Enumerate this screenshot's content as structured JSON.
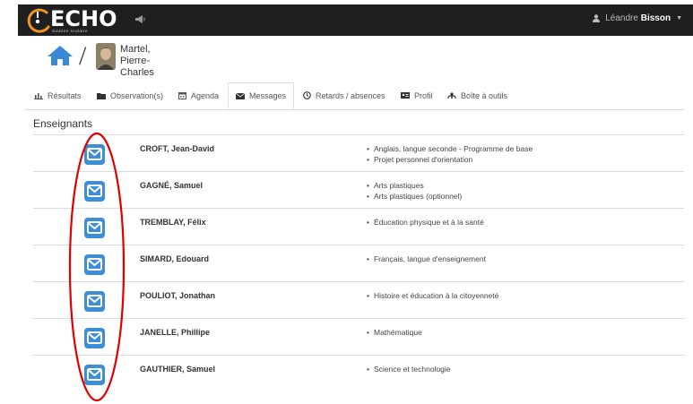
{
  "app": {
    "logo": "ECHO",
    "logo_sub": "Soutien scolaire"
  },
  "user": {
    "first_name": "Léandre",
    "last_name": "Bisson"
  },
  "breadcrumb": {
    "separator": "/",
    "student_name_line1": "Martel,",
    "student_name_line2": "Pierre-Charles"
  },
  "tabs": [
    {
      "label": "Résultats",
      "icon": "bar-chart-icon"
    },
    {
      "label": "Observation(s)",
      "icon": "folder-icon"
    },
    {
      "label": "Agenda",
      "icon": "calendar-icon"
    },
    {
      "label": "Messages",
      "icon": "envelope-icon",
      "active": true
    },
    {
      "label": "Retards / absences",
      "icon": "clock-icon"
    },
    {
      "label": "Profil",
      "icon": "id-card-icon"
    },
    {
      "label": "Boîte à outils",
      "icon": "tools-icon"
    }
  ],
  "section_title": "Enseignants",
  "teachers": [
    {
      "name": "CROFT, Jean-David",
      "courses": [
        "Anglais, langue seconde - Programme de base",
        "Projet personnel d'orientation"
      ]
    },
    {
      "name": "GAGNÉ, Samuel",
      "courses": [
        "Arts plastiques",
        "Arts plastiques (optionnel)"
      ]
    },
    {
      "name": "TREMBLAY, Félix",
      "courses": [
        "Éducation physique et à la santé"
      ]
    },
    {
      "name": "SIMARD, Edouard",
      "courses": [
        "Français, langue d'enseignement"
      ]
    },
    {
      "name": "POULIOT, Jonathan",
      "courses": [
        "Histoire et éducation à la citoyenneté"
      ]
    },
    {
      "name": "JANELLE, Phillipe",
      "courses": [
        "Mathématique"
      ]
    },
    {
      "name": "GAUTHIER, Samuel",
      "courses": [
        "Science et technologie"
      ]
    }
  ],
  "colors": {
    "navbar": "#1f1f1f",
    "accent_blue": "#3d8ed6",
    "home_blue": "#3a8ad3",
    "annotation_red": "#e00000"
  }
}
